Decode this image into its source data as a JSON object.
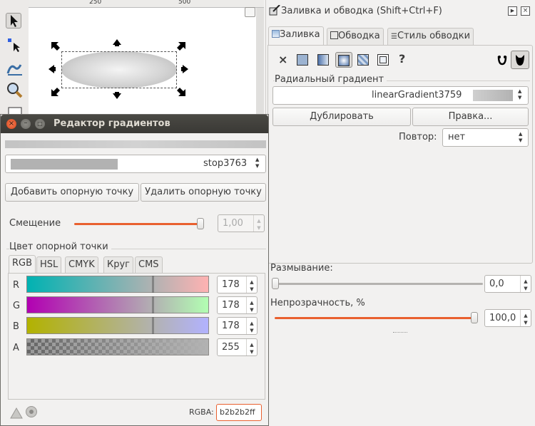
{
  "canvas": {
    "ruler_ticks": [
      "250",
      "500"
    ]
  },
  "fill_panel": {
    "title": "Заливка и обводка (Shift+Ctrl+F)",
    "tabs": [
      "Заливка",
      "Обводка",
      "Стиль обводки"
    ],
    "mode_unset": "×",
    "mode_unknown": "?",
    "gradient_type_label": "Радиальный градиент",
    "gradient_name": "linearGradient3759",
    "duplicate_button": "Дублировать",
    "edit_button": "Правка...",
    "repeat_label": "Повтор:",
    "repeat_value": "нет",
    "blur_label": "Размывание:",
    "blur_value": "0,0",
    "blur_fraction": 0.0,
    "opacity_label": "Непрозрачность, %",
    "opacity_value": "100,0",
    "opacity_fraction": 1.0
  },
  "gradient_editor": {
    "title": "Редактор градиентов",
    "stop_name": "stop3763",
    "add_stop_button": "Добавить опорную точку",
    "remove_stop_button": "Удалить опорную точку",
    "offset_label": "Смещение",
    "offset_value": "1,00",
    "offset_fraction": 1.0,
    "stop_color_label": "Цвет опорной точки",
    "color_tabs": [
      "RGB",
      "HSL",
      "CMYK",
      "Круг",
      "CMS"
    ],
    "channels": [
      {
        "label": "R",
        "value": "178"
      },
      {
        "label": "G",
        "value": "178"
      },
      {
        "label": "B",
        "value": "178"
      },
      {
        "label": "A",
        "value": "255"
      }
    ],
    "rgba_label": "RGBA:",
    "rgba_value": "b2b2b2ff"
  },
  "colors": {
    "accent": "#e9602f",
    "titlebar": "#3c3b37"
  }
}
